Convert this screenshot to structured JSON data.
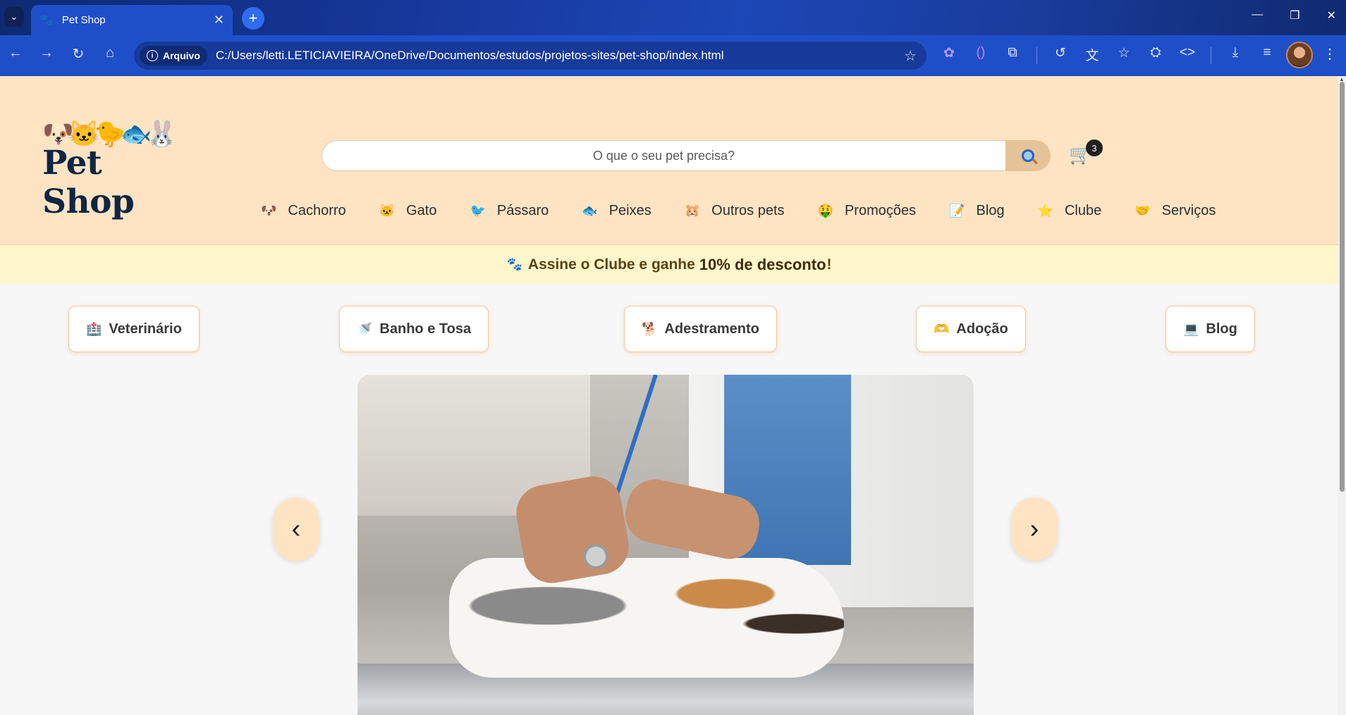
{
  "browser": {
    "tab_title": "Pet Shop",
    "security_chip": "Arquivo",
    "url": "C:/Users/letti.LETICIAVIEIRA/OneDrive/Documentos/estudos/projetos-sites/pet-shop/index.html"
  },
  "site": {
    "logo_text": "Pet Shop",
    "search_placeholder": "O que o seu pet precisa?",
    "cart_count": "3",
    "menu": [
      {
        "label": "Cachorro",
        "icon": "🐶"
      },
      {
        "label": "Gato",
        "icon": "🐱"
      },
      {
        "label": "Pássaro",
        "icon": "🐦"
      },
      {
        "label": "Peixes",
        "icon": "🐟"
      },
      {
        "label": "Outros pets",
        "icon": "🐹"
      },
      {
        "label": "Promoções",
        "icon": "🤑"
      },
      {
        "label": "Blog",
        "icon": "📝"
      },
      {
        "label": "Clube",
        "icon": "⭐"
      },
      {
        "label": "Serviços",
        "icon": "🤝"
      }
    ],
    "promo": {
      "prefix": "Assine o Clube e ganhe",
      "highlight": "10% de desconto",
      "suffix": "!"
    },
    "services": [
      {
        "label": "Veterinário",
        "icon": "🏥"
      },
      {
        "label": "Banho e Tosa",
        "icon": "🚿"
      },
      {
        "label": "Adestramento",
        "icon": "🐕"
      },
      {
        "label": "Adoção",
        "icon": "🫶"
      },
      {
        "label": "Blog",
        "icon": "💻"
      }
    ],
    "carousel": {
      "prev": "‹",
      "next": "›"
    }
  },
  "colors": {
    "header_bg": "#ffe4c4",
    "promo_bg": "#fff6cc",
    "browser_blue": "#1f4fc8"
  }
}
